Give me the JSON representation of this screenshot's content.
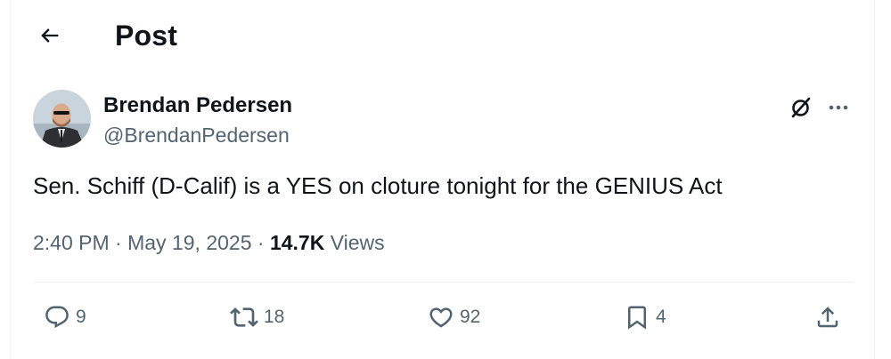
{
  "header": {
    "title": "Post",
    "back_icon": "arrow-left-icon"
  },
  "author": {
    "display_name": "Brendan Pedersen",
    "handle": "@BrendanPedersen",
    "avatar_icon": "avatar"
  },
  "tweet": {
    "text": "Sen. Schiff (D-Calif) is a YES on cloture tonight for the GENIUS Act",
    "time": "2:40 PM",
    "separator": " · ",
    "date": "May 19, 2025",
    "views_count": "14.7K",
    "views_label": "Views"
  },
  "actions": {
    "replies": "9",
    "reposts": "18",
    "likes": "92",
    "bookmarks": "4"
  },
  "colors": {
    "text_primary": "#0f1419",
    "text_secondary": "#536471",
    "divider": "#eff3f4"
  }
}
